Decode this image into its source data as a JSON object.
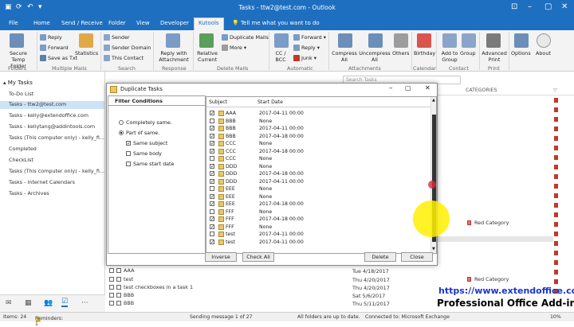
{
  "window": {
    "title": "Tasks - ttw2@test.com - Outlook"
  },
  "tabs": [
    "File",
    "Home",
    "Send / Receive",
    "Folder",
    "View",
    "Developer",
    "Kutools"
  ],
  "tell_me": "Tell me what you want to do",
  "ribbon": {
    "secure_temp_folder": "Secure Temp Folder",
    "reply": "Reply",
    "forward": "Forward",
    "save_as_txt": "Save as Txt",
    "statistics": "Statistics",
    "sender": "Sender",
    "sender_domain": "Sender Domain",
    "this_contact": "This Contact",
    "reply_with_attachment": "Reply with Attachment",
    "relative_current": "Relative Current",
    "duplicate_mails": "Duplicate Mails",
    "more": "More",
    "cc_bcc": "CC / BCC",
    "fwd": "Forward",
    "rpl": "Reply",
    "junk": "Junk",
    "compress_all": "Compress All",
    "uncompress_all": "Uncompress All",
    "others": "Others",
    "birthday": "Birthday",
    "add_to_group": "Add to Group",
    "group": "Group",
    "advanced_print": "Advanced Print",
    "options": "Options",
    "about": "About",
    "groups": {
      "folders": "Folders",
      "multiple_mails": "Multiple Mails",
      "search": "Search",
      "response": "Response",
      "delete_mails": "Delete Mails",
      "automatic": "Automatic",
      "attachments": "Attachments",
      "calendar": "Calendar",
      "contact": "Contact",
      "print": "Print"
    }
  },
  "sidebar": {
    "header": "My Tasks",
    "items": [
      "To-Do List",
      "Tasks - ttw2@test.com",
      "Tasks - kelly@extendoffice.com",
      "Tasks - kellytang@addintools.com",
      "Tasks (This computer only) - kelly_fi...",
      "Completed",
      "CheckList",
      "Tasks (This computer only) - kelly_fi...",
      "Tasks - Internet Calendars",
      "Tasks - Archives"
    ]
  },
  "search": {
    "placeholder": "Search Tasks"
  },
  "list": {
    "categories_header": "CATEGORIES",
    "rows": [
      {
        "subject": "AAA",
        "date": "Tue 4/18/2017"
      },
      {
        "subject": "test",
        "date": "Thu 4/20/2017",
        "category": "Red Category"
      },
      {
        "subject": "test checkboxes in a task 1",
        "date": "Thu 4/20/2017"
      },
      {
        "subject": "BBB",
        "date": "Sat 5/6/2017"
      },
      {
        "subject": "BBB",
        "date": "Thu 5/11/2017"
      }
    ],
    "red_category_mid": "Red Category"
  },
  "dialog": {
    "title": "Duplicate Tasks",
    "filter_header": "Filter Conditions",
    "completely_same": "Completely same.",
    "part_of_same": "Part of same.",
    "same_subject": "Same subject",
    "same_body": "Same body",
    "same_start_date": "Same start date",
    "col_subject": "Subject",
    "col_start_date": "Start Date",
    "rows": [
      {
        "checked": true,
        "subject": "AAA",
        "date": "2017-04-11 00:00"
      },
      {
        "checked": false,
        "subject": "BBB",
        "date": "None"
      },
      {
        "checked": true,
        "subject": "BBB",
        "date": "2017-04-11 00:00"
      },
      {
        "checked": true,
        "subject": "BBB",
        "date": "2017-04-18 00:00"
      },
      {
        "checked": true,
        "subject": "CCC",
        "date": "None"
      },
      {
        "checked": true,
        "subject": "CCC",
        "date": "2017-04-18 00:00"
      },
      {
        "checked": false,
        "subject": "CCC",
        "date": "None"
      },
      {
        "checked": true,
        "subject": "DDD",
        "date": "None"
      },
      {
        "checked": true,
        "subject": "DDD",
        "date": "2017-04-18 00:00"
      },
      {
        "checked": true,
        "subject": "DDD",
        "date": "2017-04-11 00:00"
      },
      {
        "checked": false,
        "subject": "EEE",
        "date": "None"
      },
      {
        "checked": true,
        "subject": "EEE",
        "date": "None"
      },
      {
        "checked": true,
        "subject": "EEE",
        "date": "2017-04-18 00:00"
      },
      {
        "checked": false,
        "subject": "FFF",
        "date": "None"
      },
      {
        "checked": true,
        "subject": "FFF",
        "date": "2017-04-18 00:00"
      },
      {
        "checked": true,
        "subject": "FFF",
        "date": "None"
      },
      {
        "checked": false,
        "subject": "test",
        "date": "2017-04-11 00:00"
      },
      {
        "checked": true,
        "subject": "test",
        "date": "2017-04-11 00:00"
      }
    ],
    "inverse": "Inverse",
    "check_all": "Check All",
    "delete": "Delete",
    "close": "Close"
  },
  "status": {
    "items": "Items: 24",
    "reminders": "Reminders: 1",
    "sending": "Sending message 1 of 27",
    "folders": "All folders are up to date.",
    "connected": "Connected to: Microsoft Exchange",
    "zoom": "10%"
  },
  "brand": {
    "url": "https://www.extendoffice.com",
    "tagline": "Professional Office Add-ins"
  },
  "colors": {
    "accent": "#1f6fc0",
    "flag": "#c0392b",
    "brand_blue": "#1a35c8"
  }
}
